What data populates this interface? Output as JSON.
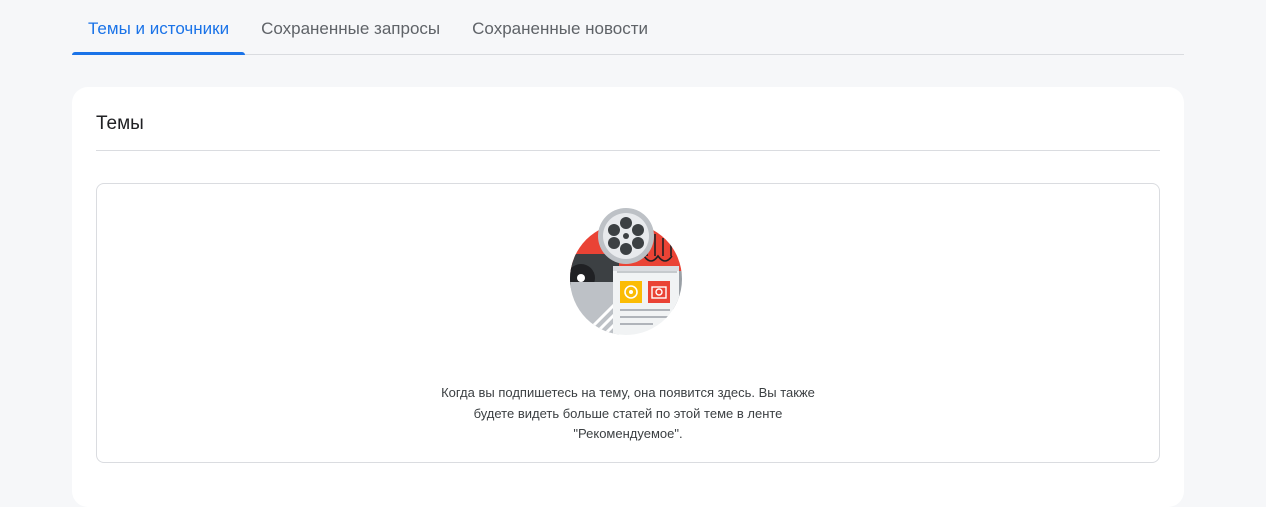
{
  "tabs": [
    {
      "label": "Темы и источники",
      "active": true
    },
    {
      "label": "Сохраненные запросы",
      "active": false
    },
    {
      "label": "Сохраненные новости",
      "active": false
    }
  ],
  "section": {
    "title": "Темы"
  },
  "empty_state": {
    "illustration_icon": "film-reel-news-illustration",
    "message": "Когда вы подпишетесь на тему, она появится здесь. Вы также будете видеть больше статей по этой теме в ленте \"Рекомендуемое\"."
  },
  "colors": {
    "accent": "#1a73e8",
    "background": "#f6f7f9"
  }
}
